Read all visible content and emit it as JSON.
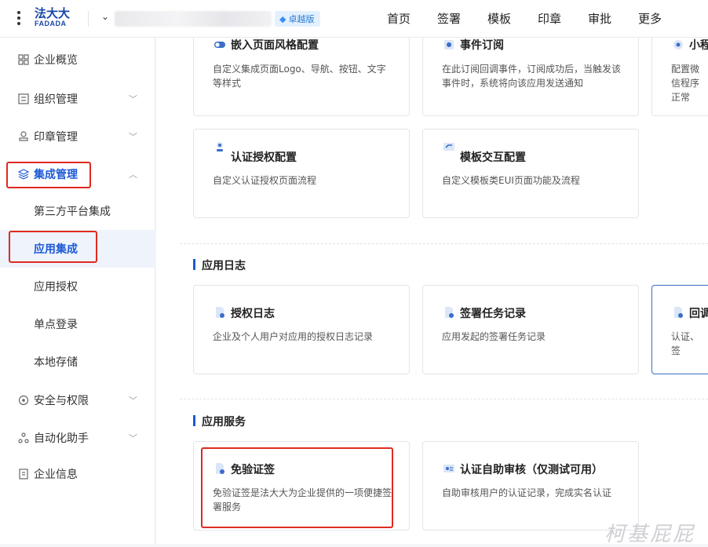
{
  "header": {
    "logo_cn": "法大大",
    "logo_en": "FADADA",
    "org_chevron": "⌄",
    "badge_label": "卓越版",
    "nav": [
      "首页",
      "签署",
      "模板",
      "印章",
      "审批",
      "更多"
    ]
  },
  "sidebar": {
    "items": [
      {
        "label": "企业概览",
        "icon": "dashboard-icon"
      },
      {
        "label": "组织管理",
        "icon": "org-icon"
      },
      {
        "label": "印章管理",
        "icon": "seal-icon"
      },
      {
        "label": "集成管理",
        "icon": "layers-icon"
      },
      {
        "label": "第三方平台集成"
      },
      {
        "label": "应用集成"
      },
      {
        "label": "应用授权"
      },
      {
        "label": "单点登录"
      },
      {
        "label": "本地存储"
      },
      {
        "label": "安全与权限",
        "icon": "security-icon"
      },
      {
        "label": "自动化助手",
        "icon": "automation-icon"
      },
      {
        "label": "企业信息",
        "icon": "info-icon"
      }
    ]
  },
  "cards_top": [
    {
      "title": "嵌入页面风格配置",
      "desc": "自定义集成页面Logo、导航、按钮、文字等样式",
      "icon": "toggle-icon"
    },
    {
      "title": "事件订阅",
      "desc": "在此订阅回调事件，订阅成功后，当触发该事件时，系统将向该应用发送通知",
      "icon": "subscribe-icon"
    },
    {
      "title": "小程",
      "desc": "配置微信程序正常",
      "icon": "miniprogram-icon"
    },
    {
      "title": "认证授权配置",
      "desc": "自定义认证授权页面流程",
      "icon": "auth-icon"
    },
    {
      "title": "模板交互配置",
      "desc": "自定义模板类EUI页面功能及流程",
      "icon": "template-icon"
    }
  ],
  "section_logs": {
    "title": "应用日志",
    "cards": [
      {
        "title": "授权日志",
        "desc": "企业及个人用户对应用的授权日志记录",
        "icon": "log-doc-icon"
      },
      {
        "title": "签署任务记录",
        "desc": "应用发起的签署任务记录",
        "icon": "sign-doc-icon"
      },
      {
        "title": "回调",
        "desc": "认证、签",
        "icon": "callback-doc-icon"
      }
    ]
  },
  "section_services": {
    "title": "应用服务",
    "cards": [
      {
        "title": "免验证签",
        "desc": "免验证签是法大大为企业提供的一项便捷签署服务",
        "icon": "free-sign-icon"
      },
      {
        "title": "认证自助审核（仅测试可用）",
        "desc": "自助审核用户的认证记录，完成实名认证",
        "icon": "id-card-icon"
      }
    ]
  },
  "watermark": "柯基屁屁"
}
